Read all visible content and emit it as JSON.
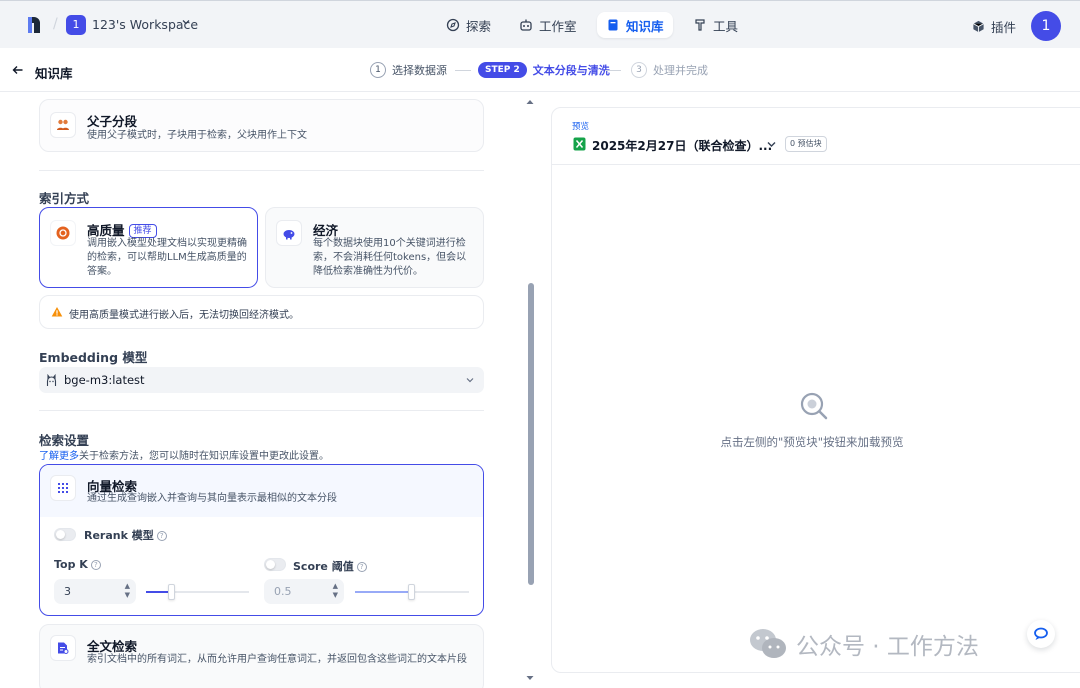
{
  "topbar": {
    "workspace_badge": "1",
    "workspace_name": "123's Workspace",
    "nav": [
      {
        "label": "探索",
        "icon": "compass-icon"
      },
      {
        "label": "工作室",
        "icon": "robot-icon"
      },
      {
        "label": "知识库",
        "icon": "book-icon",
        "active": true
      },
      {
        "label": "工具",
        "icon": "hammer-icon"
      }
    ],
    "plugin_label": "插件",
    "avatar_initial": "1"
  },
  "subbar": {
    "back_label": "知识库",
    "steps": [
      {
        "num": "1",
        "label": "选择数据源"
      },
      {
        "pill": "STEP 2",
        "label": "文本分段与清洗"
      },
      {
        "num": "3",
        "label": "处理并完成"
      }
    ]
  },
  "parent_child": {
    "title": "父子分段",
    "desc": "使用父子模式时，子块用于检索，父块用作上下文"
  },
  "index": {
    "title": "索引方式",
    "high": {
      "title": "高质量",
      "badge": "推荐",
      "desc": "调用嵌入模型处理文档以实现更精确的检索，可以帮助LLM生成高质量的答案。"
    },
    "econ": {
      "title": "经济",
      "desc": "每个数据块使用10个关键词进行检索，不会消耗任何tokens，但会以降低检索准确性为代价。"
    },
    "warning": "使用高质量模式进行嵌入后，无法切换回经济模式。"
  },
  "embedding": {
    "title": "Embedding 模型",
    "value": "bge-m3:latest"
  },
  "retrieval": {
    "title": "检索设置",
    "learn_more": "了解更多",
    "desc": "关于检索方法，您可以随时在知识库设置中更改此设置。",
    "vector": {
      "title": "向量检索",
      "desc": "通过生成查询嵌入并查询与其向量表示最相似的文本分段"
    },
    "rerank_label": "Rerank 模型",
    "topk_label": "Top K",
    "topk_value": "3",
    "score_label": "Score 阈值",
    "score_value": "0.5",
    "fulltext": {
      "title": "全文检索",
      "desc": "索引文档中的所有词汇，从而允许用户查询任意词汇，并返回包含这些词汇的文本片段"
    }
  },
  "preview": {
    "label": "预览",
    "doc_title": "2025年2月27日（联合检查）...",
    "chunk_count": "0 预估块",
    "empty_text": "点击左侧的\"预览块\"按钮来加载预览"
  },
  "watermark": "公众号 · 工作方法"
}
